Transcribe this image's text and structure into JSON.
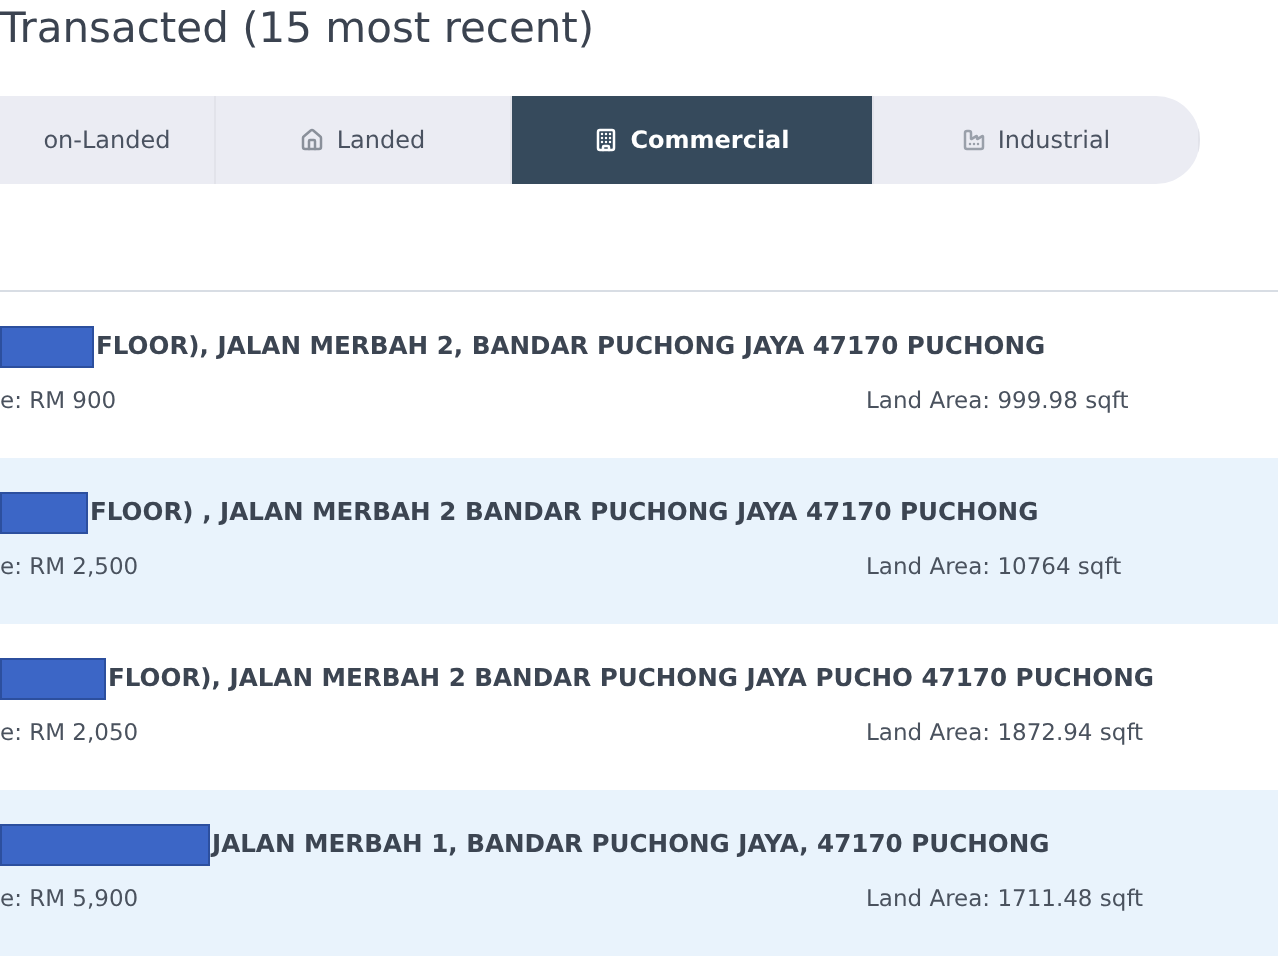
{
  "section_title": "Transacted (15 most recent)",
  "tabs": [
    {
      "label": "on-Landed",
      "kind": "plain",
      "selected": false
    },
    {
      "label": "Landed",
      "kind": "landed",
      "selected": false
    },
    {
      "label": "Commercial",
      "kind": "commercial",
      "selected": true
    },
    {
      "label": "Industrial",
      "kind": "industrial",
      "selected": false
    }
  ],
  "transactions": [
    {
      "address": "FLOOR), JALAN MERBAH 2, BANDAR PUCHONG JAYA 47170 PUCHONG",
      "price": "e: RM 900",
      "land_area": "Land Area: 999.98 sqft"
    },
    {
      "address": "FLOOR) , JALAN MERBAH 2 BANDAR PUCHONG JAYA 47170 PUCHONG",
      "price": "e: RM 2,500",
      "land_area": "Land Area: 10764 sqft"
    },
    {
      "address": "FLOOR), JALAN MERBAH 2 BANDAR PUCHONG JAYA PUCHO 47170 PUCHONG",
      "price": "e: RM 2,050",
      "land_area": "Land Area: 1872.94 sqft"
    },
    {
      "address": "JALAN MERBAH 1, BANDAR PUCHONG JAYA, 47170 PUCHONG",
      "price": "e: RM 5,900",
      "land_area": "Land Area: 1711.48 sqft"
    }
  ]
}
